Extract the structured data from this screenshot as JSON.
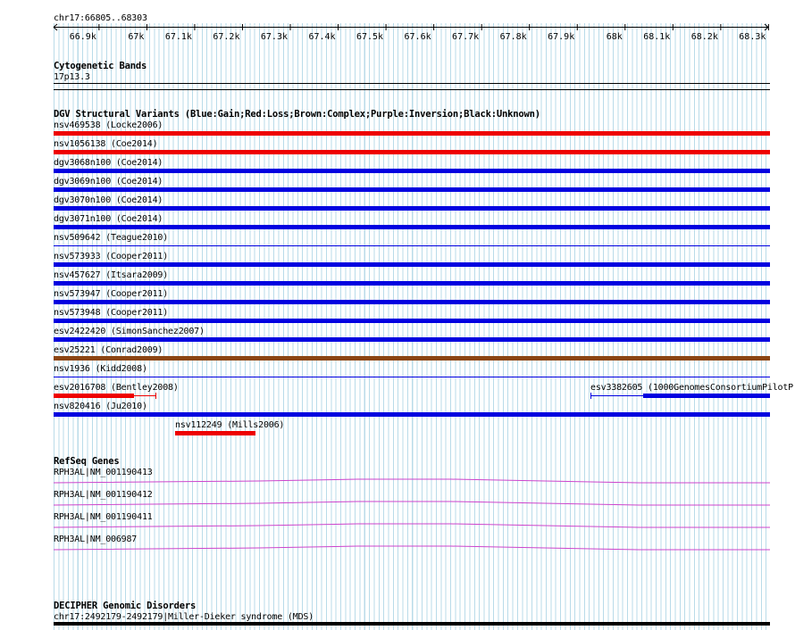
{
  "locus": "chr17:66805..68303",
  "ruler": {
    "ticks": [
      {
        "pos": 66900,
        "label": "66.9k"
      },
      {
        "pos": 67000,
        "label": "67k"
      },
      {
        "pos": 67100,
        "label": "67.1k"
      },
      {
        "pos": 67200,
        "label": "67.2k"
      },
      {
        "pos": 67300,
        "label": "67.3k"
      },
      {
        "pos": 67400,
        "label": "67.4k"
      },
      {
        "pos": 67500,
        "label": "67.5k"
      },
      {
        "pos": 67600,
        "label": "67.6k"
      },
      {
        "pos": 67700,
        "label": "67.7k"
      },
      {
        "pos": 67800,
        "label": "67.8k"
      },
      {
        "pos": 67900,
        "label": "67.9k"
      },
      {
        "pos": 68000,
        "label": "68k"
      },
      {
        "pos": 68100,
        "label": "68.1k"
      },
      {
        "pos": 68200,
        "label": "68.2k"
      },
      {
        "pos": 68300,
        "label": "68.3k"
      }
    ]
  },
  "tracks": {
    "cytoband": {
      "title": "Cytogenetic Bands",
      "band": "17p13.3"
    },
    "dgv": {
      "title": "DGV Structural Variants (Blue:Gain;Red:Loss;Brown:Complex;Purple:Inversion;Black:Unknown)",
      "colors": {
        "gain": "#0000e0",
        "loss": "#ee0000",
        "complex": "#8b4513",
        "unknown": "#000000"
      },
      "variants": [
        {
          "label": "nsv469538 (Locke2006)",
          "type": "loss"
        },
        {
          "label": "nsv1056138 (Coe2014)",
          "type": "loss"
        },
        {
          "label": "dgv3068n100 (Coe2014)",
          "type": "gain"
        },
        {
          "label": "dgv3069n100 (Coe2014)",
          "type": "gain"
        },
        {
          "label": "dgv3070n100 (Coe2014)",
          "type": "gain"
        },
        {
          "label": "dgv3071n100 (Coe2014)",
          "type": "gain"
        },
        {
          "label": "nsv509642 (Teague2010)",
          "type": "unknown"
        },
        {
          "label": "nsv573933 (Cooper2011)",
          "type": "gain"
        },
        {
          "label": "nsv457627 (Itsara2009)",
          "type": "gain"
        },
        {
          "label": "nsv573947 (Cooper2011)",
          "type": "gain"
        },
        {
          "label": "nsv573948 (Cooper2011)",
          "type": "gain"
        },
        {
          "label": "esv2422420 (SimonSanchez2007)",
          "type": "gain"
        },
        {
          "label": "esv25221 (Conrad2009)",
          "type": "complex"
        },
        {
          "label": "nsv1936 (Kidd2008)",
          "type": "gain"
        }
      ],
      "extra": {
        "bentley": {
          "label": "esv2016708 (Bentley2008)",
          "type": "loss"
        },
        "consortium": {
          "label": "esv3382605 (1000GenomesConsortiumPilotP",
          "type": "gain"
        },
        "ju": {
          "label": "nsv820416 (Ju2010)",
          "type": "gain"
        },
        "mills": {
          "label": "nsv112249 (Mills2006)",
          "type": "loss"
        }
      }
    },
    "refseq": {
      "title": "RefSeq Genes",
      "color": "#cc44cc",
      "genes": [
        {
          "label": "RPH3AL|NM_001190413"
        },
        {
          "label": "RPH3AL|NM_001190412"
        },
        {
          "label": "RPH3AL|NM_001190411"
        },
        {
          "label": "RPH3AL|NM_006987"
        }
      ]
    },
    "decipher": {
      "title": "DECIPHER Genomic Disorders",
      "item": "chr17:2492179-2492179|Miller-Dieker syndrome (MDS)"
    }
  }
}
